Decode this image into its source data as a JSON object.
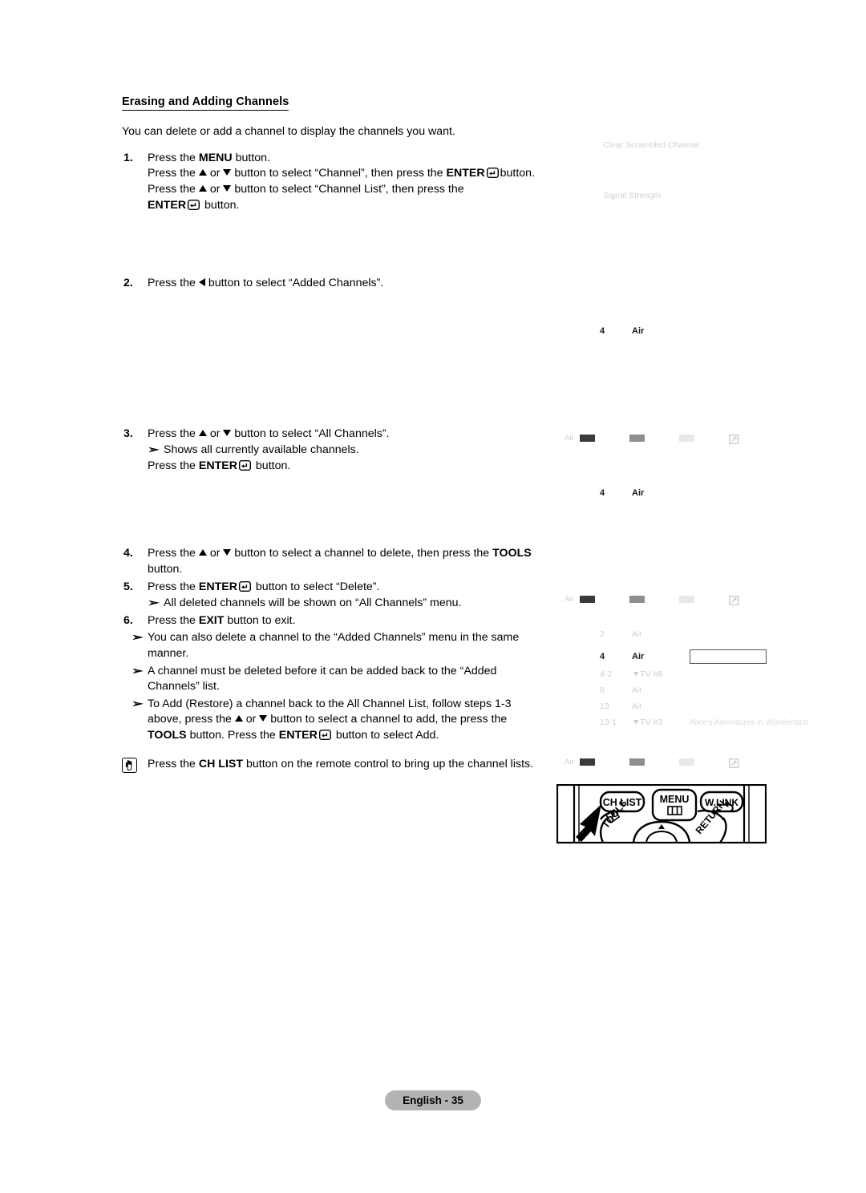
{
  "document": {
    "section_title": "Erasing and Adding Channels",
    "intro": "You can delete or add a channel to display the channels you want.",
    "steps": [
      {
        "num": "1.",
        "lines": [
          "Press the MENU button.",
          "Press the ▲ or ▼ button to select “Channel”, then press the ENTER ↵ button.",
          "Press the ▲ or ▼ button to select “Channel List”, then press the ENTER ↵ button."
        ]
      },
      {
        "num": "2.",
        "lines": [
          "Press the ◀ button to select “Added Channels”."
        ]
      },
      {
        "num": "3.",
        "lines": [
          "Press the ▲ or ▼ button to select “All Channels”.",
          "Shows all currently available channels.",
          "Press the ENTER ↵ button."
        ]
      },
      {
        "num": "4.",
        "lines": [
          "Press the ▲ or ▼ button to select a channel to delete, then press the TOOLS button."
        ]
      },
      {
        "num": "5.",
        "lines": [
          "Press the ENTER ↵ button to select “Delete”.",
          "All deleted channels will be shown on “All Channels” menu."
        ]
      },
      {
        "num": "6.",
        "lines": [
          "Press the EXIT button to exit."
        ]
      }
    ],
    "step1": {
      "l1_a": "Press the ",
      "l1_menu": "MENU",
      "l1_b": " button.",
      "l2_a": "Press the ",
      "l2_b": " or ",
      "l2_c": " button to select “Channel”, then press the ",
      "l2_enter": "ENTER",
      "l2_d": "button.",
      "l3_a": "Press the ",
      "l3_b": " or ",
      "l3_c": " button to select “Channel List”, then press the ",
      "l3_enter": "ENTER",
      "l3_d": " button."
    },
    "step2": {
      "a": "Press the ",
      "b": " button to select “Added Channels”."
    },
    "step3": {
      "a": "Press the ",
      "b": " or ",
      "c": " button to select “All Channels”.",
      "note": "Shows all currently available channels.",
      "d": "Press the ",
      "enter": "ENTER",
      "e": " button."
    },
    "step4": {
      "a": "Press the ",
      "b": " or ",
      "c": " button to select a channel to delete, then press the ",
      "tools": "TOOLS",
      "d": " button."
    },
    "step5": {
      "a": "Press the ",
      "enter": "ENTER",
      "b": " button to select “Delete”.",
      "note": "All deleted channels will be shown on “All Channels” menu."
    },
    "step6": {
      "a": "Press the ",
      "exit": "EXIT",
      "b": " button to exit."
    },
    "notes": [
      "You can also delete a channel to the “Added Channels” menu in the same manner.",
      "A channel must be deleted before it can be added back to the “Added Channels” list."
    ],
    "note_restore": {
      "a": "To Add (Restore) a channel back to the All Channel List, follow steps 1-3 above, press the ",
      "b": " or ",
      "c": " button to select a channel to add, the press the ",
      "tools": "TOOLS",
      "d": " button. Press the ",
      "enter": "ENTER",
      "e": " button to select Add."
    },
    "note_remote": {
      "a": "Press the ",
      "chlist": "CH LIST",
      "b": " button on the remote control to bring up the channel lists."
    },
    "note_marker": "➢",
    "footer": "English - 35"
  },
  "osd": {
    "menu_items": [
      {
        "label": "Clear Scrambled Channel"
      },
      {
        "label": "Signal Strength"
      }
    ],
    "panel2": {
      "row": {
        "num": "4",
        "name": "Air"
      }
    },
    "panel3": {
      "row": {
        "num": "4",
        "name": "Air"
      }
    },
    "channel_list": [
      {
        "num": "2",
        "name": "Air",
        "program": "",
        "selected": false
      },
      {
        "num": "4",
        "name": "Air",
        "program": "",
        "selected": true
      },
      {
        "num": "4-2",
        "name": "▼TV #8",
        "program": "",
        "selected": false
      },
      {
        "num": "8",
        "name": "Air",
        "program": "",
        "selected": false
      },
      {
        "num": "13",
        "name": "Air",
        "program": "",
        "selected": false
      },
      {
        "num": "13-1",
        "name": "▼TV #3",
        "program": "Alice's Adventures in Wonderland",
        "selected": false
      }
    ],
    "legend": {
      "label": "Air",
      "swatch_colors": [
        "#3a3a3a",
        "#8e8e8e",
        "#e8e8e8"
      ]
    }
  },
  "remote": {
    "buttons": {
      "ch_list": "CH LIST",
      "menu": "MENU",
      "w_link": "W.LINK",
      "tools": "TOOLS",
      "return": "RETURN"
    }
  }
}
